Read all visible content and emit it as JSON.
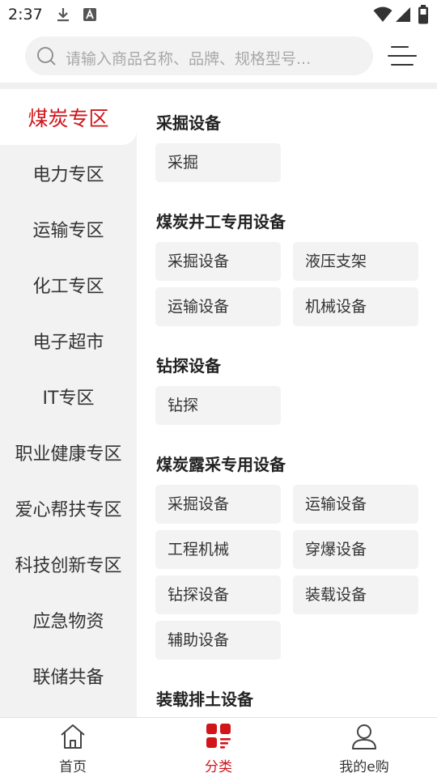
{
  "status_bar": {
    "time": "2:37",
    "icons": [
      "download-icon",
      "font-icon",
      "wifi-icon",
      "signal-icon",
      "battery-icon"
    ]
  },
  "search": {
    "placeholder": "请输入商品名称、品牌、规格型号..."
  },
  "colors": {
    "accent": "#d0151b",
    "sidebar_bg": "#f2f2f2",
    "chip_bg": "#f3f3f3"
  },
  "sidebar": {
    "items": [
      {
        "label": "煤炭专区",
        "active": true
      },
      {
        "label": "电力专区"
      },
      {
        "label": "运输专区"
      },
      {
        "label": "化工专区"
      },
      {
        "label": "电子超市"
      },
      {
        "label": "IT专区"
      },
      {
        "label": "职业健康专区"
      },
      {
        "label": "爱心帮扶专区"
      },
      {
        "label": "科技创新专区"
      },
      {
        "label": "应急物资"
      },
      {
        "label": "联储共备"
      }
    ]
  },
  "sections": [
    {
      "title": "采掘设备",
      "items": [
        "采掘"
      ]
    },
    {
      "title": "煤炭井工专用设备",
      "items": [
        "采掘设备",
        "液压支架",
        "运输设备",
        "机械设备"
      ]
    },
    {
      "title": "钻探设备",
      "items": [
        "钻探"
      ]
    },
    {
      "title": "煤炭露采专用设备",
      "items": [
        "采掘设备",
        "运输设备",
        "工程机械",
        "穿爆设备",
        "钻探设备",
        "装载设备",
        "辅助设备"
      ]
    },
    {
      "title": "装载排土设备",
      "items": []
    }
  ],
  "bottom_nav": [
    {
      "label": "首页",
      "icon": "home-icon"
    },
    {
      "label": "分类",
      "icon": "category-icon",
      "active": true
    },
    {
      "label": "我的e购",
      "icon": "user-icon"
    }
  ]
}
